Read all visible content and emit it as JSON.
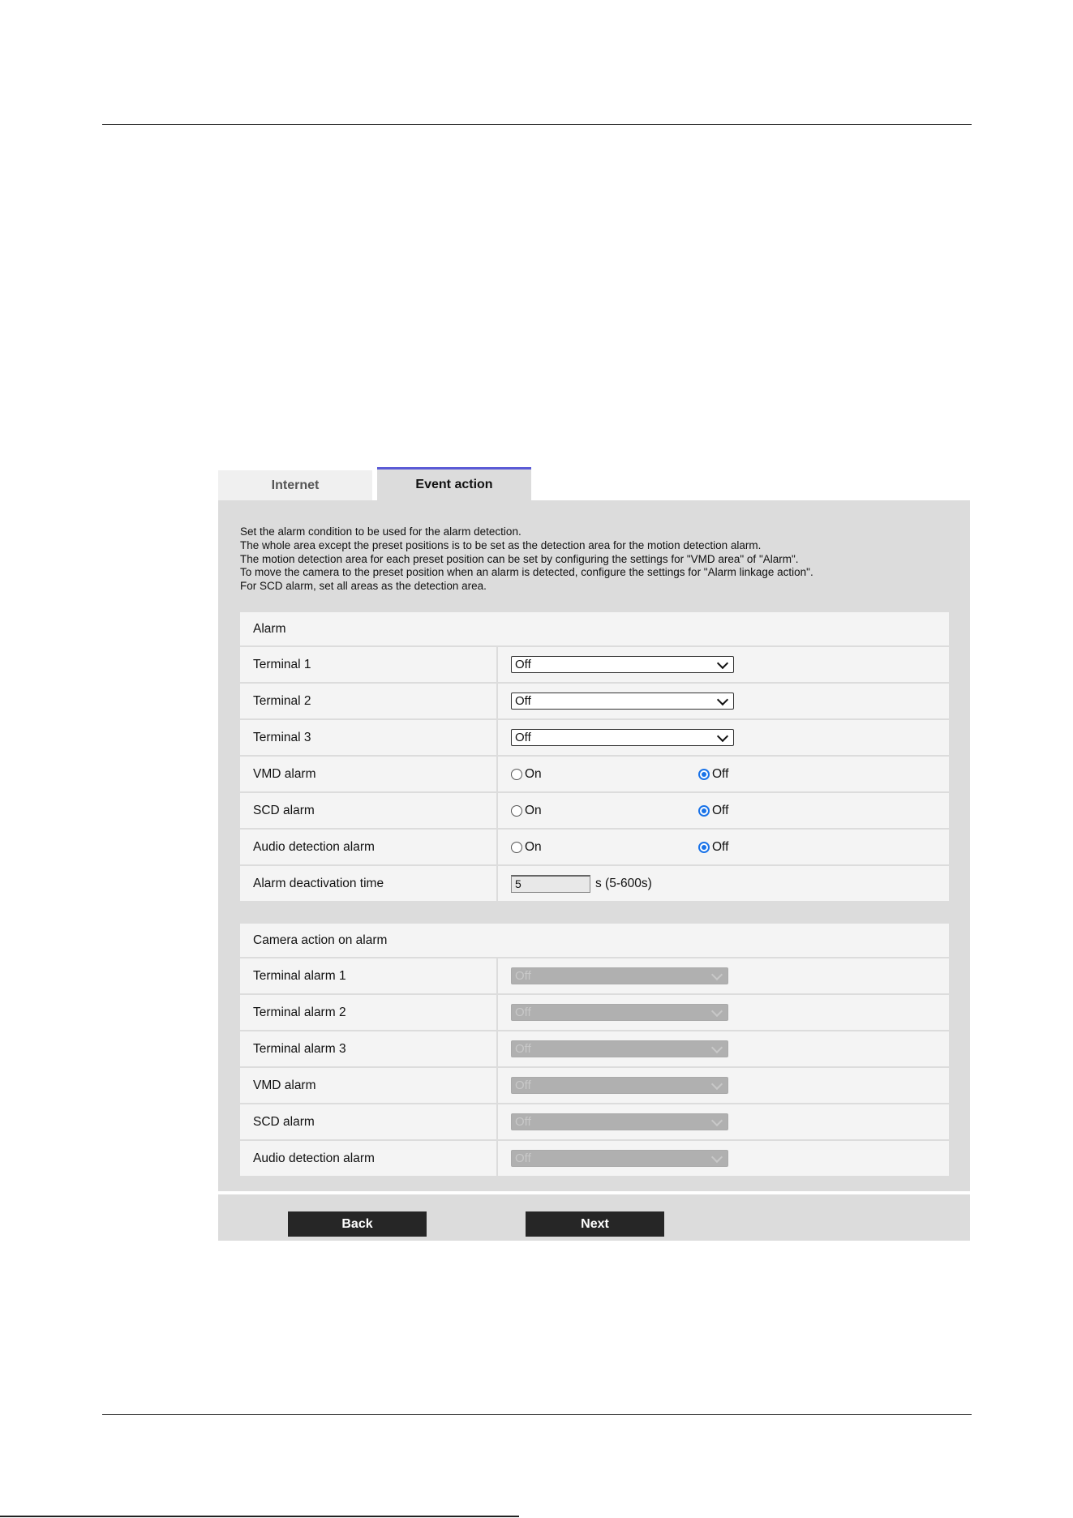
{
  "tabs": {
    "internet": "Internet",
    "event_action": "Event action"
  },
  "intro": [
    "Set the alarm condition to be used for the alarm detection.",
    "The whole area except the preset positions is to be set as the detection area for the motion detection alarm.",
    "The motion detection area for each preset position can be set by configuring the settings for \"VMD area\" of \"Alarm\".",
    "To move the camera to the preset position when an alarm is detected, configure the settings for \"Alarm linkage action\".",
    "For SCD alarm, set all areas as the detection area."
  ],
  "alarm": {
    "heading": "Alarm",
    "terminal1": {
      "label": "Terminal 1",
      "value": "Off"
    },
    "terminal2": {
      "label": "Terminal 2",
      "value": "Off"
    },
    "terminal3": {
      "label": "Terminal 3",
      "value": "Off"
    },
    "vmd": {
      "label": "VMD alarm",
      "on": "On",
      "off": "Off",
      "selected": "Off"
    },
    "scd": {
      "label": "SCD alarm",
      "on": "On",
      "off": "Off",
      "selected": "Off"
    },
    "audio": {
      "label": "Audio detection alarm",
      "on": "On",
      "off": "Off",
      "selected": "Off"
    },
    "deactivation": {
      "label": "Alarm deactivation time",
      "value": "5",
      "unit": "s (5-600s)"
    }
  },
  "camera_action": {
    "heading": "Camera action on alarm",
    "rows": [
      {
        "label": "Terminal alarm 1",
        "value": "Off"
      },
      {
        "label": "Terminal alarm 2",
        "value": "Off"
      },
      {
        "label": "Terminal alarm 3",
        "value": "Off"
      },
      {
        "label": "VMD alarm",
        "value": "Off"
      },
      {
        "label": "SCD alarm",
        "value": "Off"
      },
      {
        "label": "Audio detection alarm",
        "value": "Off"
      }
    ]
  },
  "buttons": {
    "back": "Back",
    "next": "Next"
  },
  "colors": {
    "active_tab_accent": "#5b5bd6",
    "radio_checked": "#1a73e8",
    "button_bg": "#262626"
  }
}
